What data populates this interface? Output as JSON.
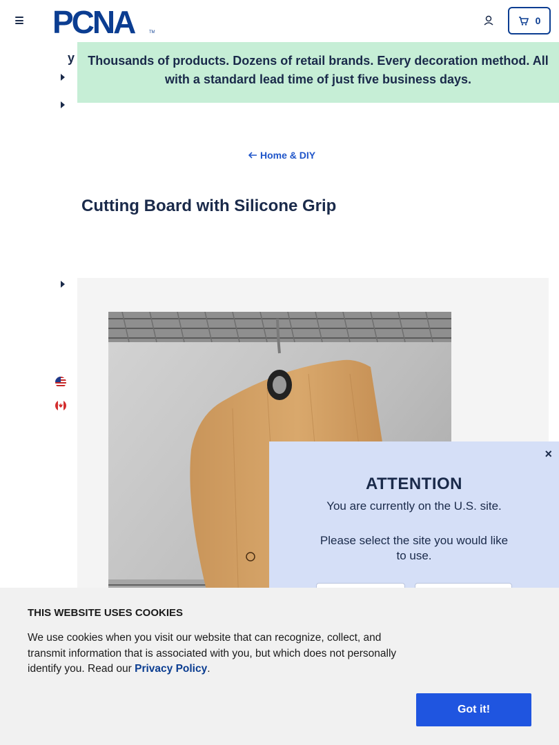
{
  "header": {
    "logo_text": "PCNA",
    "cart_count": "0"
  },
  "promo": {
    "fragment": "y",
    "text": "Thousands of products. Dozens of retail brands. Every decoration method. All with a standard lead time of just five business days."
  },
  "breadcrumb": {
    "label": "Home & DIY"
  },
  "product": {
    "title": "Cutting Board with Silicone Grip"
  },
  "modal": {
    "title": "ATTENTION",
    "line1": "You are currently on the U.S. site.",
    "line2": "Please select the site you would like to use.",
    "close_label": "×"
  },
  "cookie": {
    "title": "THIS WEBSITE USES COOKIES",
    "body": "We use cookies when you visit our website that can recognize, collect, and transmit information that is associated with you, but which does not personally identify you. Read our",
    "link": "Privacy Policy",
    "suffix": ".",
    "button": "Got it!"
  },
  "colors": {
    "brand_blue": "#0b3d91",
    "link_blue": "#1f55c9",
    "promo_green": "#c6eed6",
    "modal_bg": "#d5dff7",
    "cookie_button": "#1f55e0"
  },
  "icons": [
    "menu-icon",
    "account-icon",
    "cart-icon",
    "arrow-left-icon",
    "caret-right-icon",
    "us-flag-icon",
    "canada-flag-icon",
    "close-icon"
  ]
}
